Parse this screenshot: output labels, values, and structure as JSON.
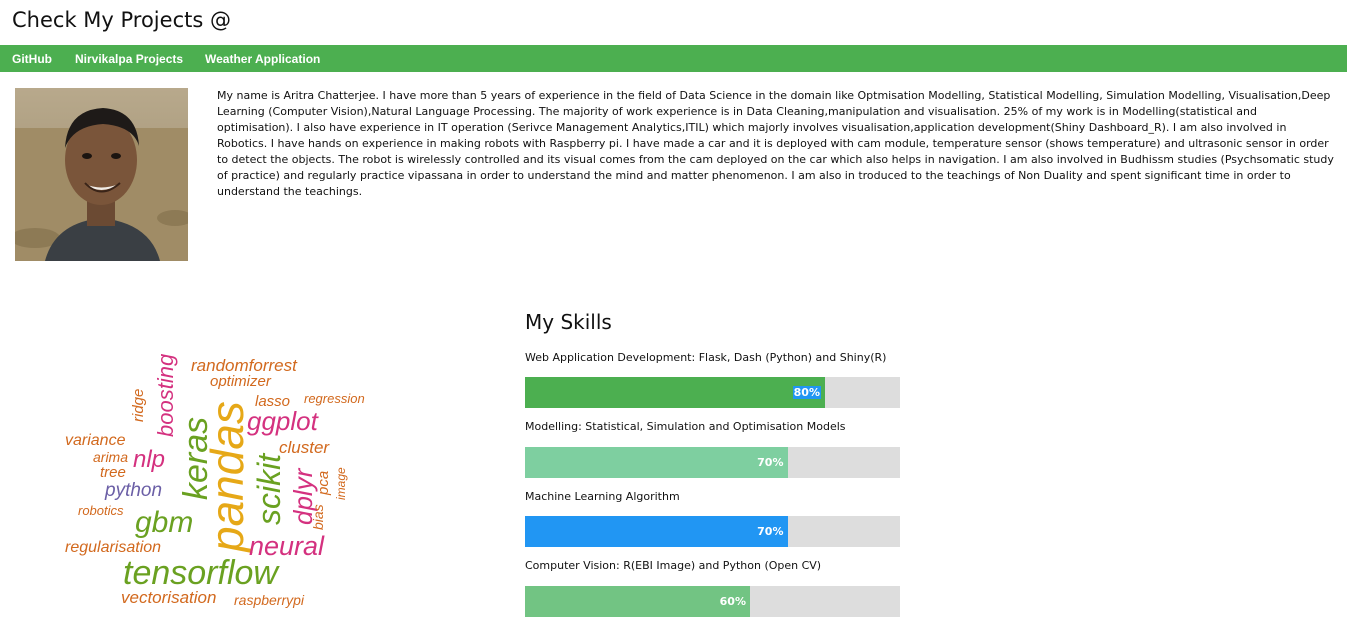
{
  "header": {
    "title": "Check My Projects @"
  },
  "nav": {
    "items": [
      "GitHub",
      "Nirvikalpa Projects",
      "Weather Application"
    ]
  },
  "about": {
    "bio": "My name is Aritra Chatterjee. I have more than 5 years of experience in the field of Data Science in the domain like Optmisation Modelling, Statistical Modelling, Simulation Modelling, Visualisation,Deep Learning (Computer Vision),Natural Language Processing. The majority of work experience is in Data Cleaning,manipulation and visualisation. 25% of my work is in Modelling(statistical and optimisation). I also have experience in IT operation (Serivce Management Analytics,ITIL) which majorly involves visualisation,application development(Shiny Dashboard_R). I am also involved in Robotics. I have hands on experience in making robots with Raspberry pi. I have made a car and it is deployed with cam module, temperature sensor (shows temperature) and ultrasonic sensor in order to detect the objects. The robot is wirelessly controlled and its visual comes from the cam deployed on the car which also helps in navigation. I am also involved in Budhissm studies (Psychsomatic study of practice) and regularly practice vipassana in order to understand the mind and matter phenomenon. I am also in troduced to the teachings of Non Duality and spent significant time in order to understand the teachings."
  },
  "wordcloud": {
    "words": [
      "pandas",
      "tensorflow",
      "keras",
      "scikit",
      "gbm",
      "neural",
      "ggplot",
      "dplyr",
      "boosting",
      "nlp",
      "python",
      "randomforrest",
      "optimizer",
      "lasso",
      "regression",
      "cluster",
      "ridge",
      "variance",
      "arima",
      "tree",
      "robotics",
      "regularisation",
      "vectorisation",
      "raspberrypi",
      "pca",
      "bias",
      "image"
    ],
    "colors": {
      "orange": "#d2691e",
      "green": "#6aa121",
      "pink": "#d4317f",
      "gold": "#e6a817",
      "purple": "#6b5fa6",
      "lightorange": "#e08a35"
    }
  },
  "skills": {
    "title": "My Skills",
    "items": [
      {
        "label": "Web Application Development: Flask, Dash (Python) and Shiny(R)",
        "percent_text": "80%",
        "value": 80,
        "color": "#4caf50",
        "highlighted": true
      },
      {
        "label": "Modelling: Statistical, Simulation and Optimisation Models",
        "percent_text": "70%",
        "value": 70,
        "color": "#7ecfa0",
        "highlighted": false
      },
      {
        "label": "Machine Learning Algorithm",
        "percent_text": "70%",
        "value": 70,
        "color": "#2196f3",
        "highlighted": false
      },
      {
        "label": "Computer Vision: R(EBI Image) and Python (Open CV)",
        "percent_text": "60%",
        "value": 60,
        "color": "#72c483",
        "highlighted": false
      }
    ]
  }
}
